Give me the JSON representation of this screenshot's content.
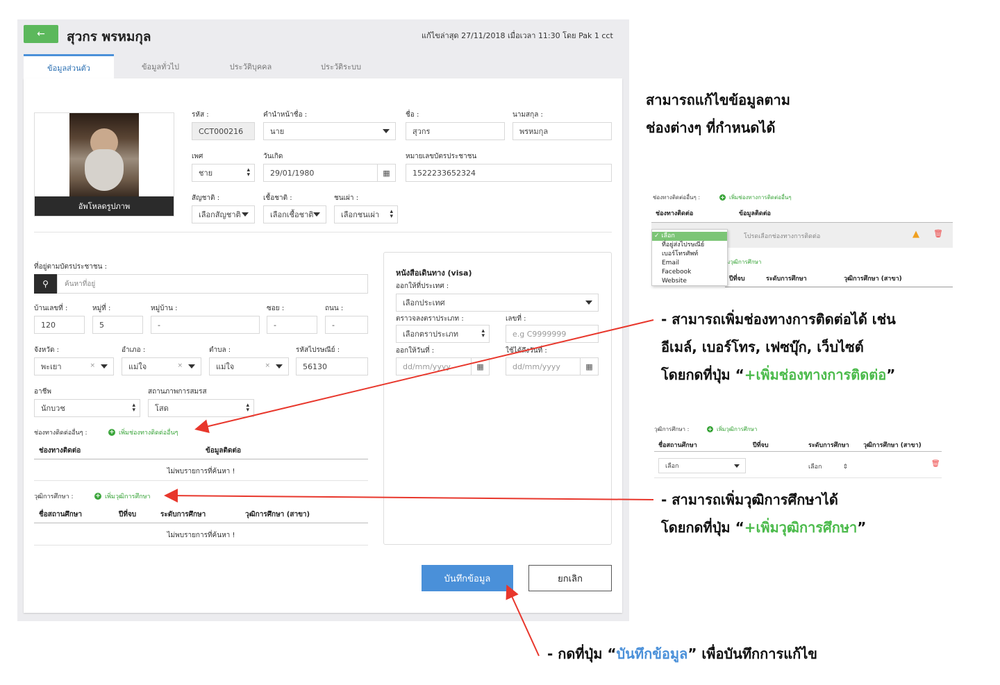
{
  "header": {
    "back_icon": "←",
    "title": "สุวกร พรหมกุล",
    "last_edit": "แก้ไขล่าสุด 27/11/2018 เมื่อเวลา 11:30 โดย Pak 1 cct"
  },
  "tabs": [
    "ข้อมูลส่วนตัว",
    "ข้อมูลทั่วไป",
    "ประวัติบุคคล",
    "ประวัติระบบ"
  ],
  "photo": {
    "upload_label": "อัพโหลดรูปภาพ"
  },
  "personal": {
    "code_label": "รหัส :",
    "code_value": "CCT000216",
    "prefix_label": "คำนำหน้าชื่อ :",
    "prefix_value": "นาย",
    "first_label": "ชื่อ :",
    "first_value": "สุวกร",
    "last_label": "นามสกุล :",
    "last_value": "พรหมกุล",
    "gender_label": "เพศ",
    "gender_value": "ชาย",
    "dob_label": "วันเกิด",
    "dob_value": "29/01/1980",
    "idcard_label": "หมายเลขบัตรประชาชน",
    "idcard_value": "1522233652324",
    "nationality_label": "สัญชาติ :",
    "nationality_value": "เลือกสัญชาติ",
    "race_label": "เชื้อชาติ :",
    "race_value": "เลือกเชื้อชาติ",
    "tribe_label": "ชนเผ่า :",
    "tribe_value": "เลือกชนเผ่า"
  },
  "address": {
    "label": "ที่อยู่ตามบัตรประชาชน :",
    "search_placeholder": "ค้นหาที่อยู่",
    "house_label": "บ้านเลขที่ :",
    "house_value": "120",
    "moo_label": "หมู่ที่ :",
    "moo_value": "5",
    "village_label": "หมู่บ้าน :",
    "village_value": "-",
    "soi_label": "ซอย :",
    "soi_value": "-",
    "road_label": "ถนน :",
    "road_value": "-",
    "province_label": "จังหวัด :",
    "province_value": "พะเยา",
    "district_label": "อำเภอ :",
    "district_value": "แม่ใจ",
    "subdistrict_label": "ตำบล :",
    "subdistrict_value": "แม่ใจ",
    "zip_label": "รหัสไปรษณีย์ :",
    "zip_value": "56130",
    "job_label": "อาชีพ",
    "job_value": "นักบวช",
    "marital_label": "สถานภาพการสมรส",
    "marital_value": "โสด"
  },
  "contacts": {
    "label": "ช่องทางติดต่ออื่นๆ :",
    "add_link": "เพิ่มช่องทางติดต่ออื่นๆ",
    "col1": "ช่องทางติดต่อ",
    "col2": "ข้อมูลติดต่อ",
    "empty": "ไม่พบรายการที่ค้นหา !"
  },
  "education": {
    "label": "วุฒิการศึกษา :",
    "add_link": "เพิ่มวุฒิการศึกษา",
    "cols": [
      "ชื่อสถานศึกษา",
      "ปีที่จบ",
      "ระดับการศึกษา",
      "วุฒิการศึกษา (สาขา)"
    ],
    "empty": "ไม่พบรายการที่ค้นหา !"
  },
  "visa": {
    "title": "หนังสือเดินทาง (visa)",
    "country_label": "ออกให้ที่ประเทศ :",
    "country_value": "เลือกประเทศ",
    "type_label": "ตราวจลงตราประเภท :",
    "type_value": "เลือกตราประเภท",
    "number_label": "เลขที่ :",
    "number_placeholder": "e.g C9999999",
    "issue_label": "ออกให้วันที่ :",
    "issue_placeholder": "dd/mm/yyyy",
    "expire_label": "ใช้ได้ถึงวันที่ :",
    "expire_placeholder": "dd/mm/yyyy"
  },
  "actions": {
    "save": "บันทึกข้อมูล",
    "cancel": "ยกเลิก"
  },
  "annotations": {
    "a1_line1": "สามารถแก้ไขข้อมูลตาม",
    "a1_line2": "ช่องต่างๆ ที่กำหนดได้",
    "a2_line1": "- สามารถเพิ่มช่องทางการติดต่อได้ เช่น",
    "a2_line2": "อีเมล์, เบอร์โทร, เฟซบุ๊ก, เว็บไซต์",
    "a2_line3_pre": "โดยกดที่ปุ่ม “",
    "a2_line3_link": "+เพิ่มช่องทางการติดต่อ",
    "a2_line3_post": "”",
    "a3_line1": "- สามารถเพิ่มวุฒิการศึกษาได้",
    "a3_line2_pre": "โดยกดที่ปุ่ม “",
    "a3_line2_link": "+เพิ่มวุฒิการศึกษา",
    "a3_line2_post": "”",
    "a4_pre": "- กดที่ปุ่ม “",
    "a4_link": "บันทึกข้อมูล",
    "a4_post": "” เพื่อบันทึกการแก้ไข"
  },
  "mini_contact": {
    "label": "ช่องทางติดต่ออื่นๆ :",
    "add_link": "เพิ่มช่องทางการติดต่ออื่นๆ",
    "col1": "ช่องทางติดต่อ",
    "col2": "ข้อมูลติดต่อ",
    "placeholder": "โปรดเลือกช่องทางการติดต่อ",
    "options": [
      "✓ เลือก",
      "ที่อยู่ส่งไปรษณีย์",
      "เบอร์โทรศัพท์",
      "Email",
      "Facebook",
      "Website"
    ],
    "edu_partial": "มวุฒิการศึกษา",
    "col_year": "ปีที่จบ",
    "col_level": "ระดับการศึกษา",
    "col_degree": "วุฒิการศึกษา (สาขา)"
  },
  "mini_edu": {
    "label": "วุฒิการศึกษา :",
    "add_link": "เพิ่มวุฒิการศึกษา",
    "cols": [
      "ชื่อสถานศึกษา",
      "ปีที่จบ",
      "ระดับการศึกษา",
      "วุฒิการศึกษา (สาขา)"
    ],
    "select_value": "เลือก",
    "level_value": "เลือก"
  },
  "colors": {
    "accent": "#4a90d9",
    "green": "#3aa53a",
    "arrow": "#e8372c"
  }
}
